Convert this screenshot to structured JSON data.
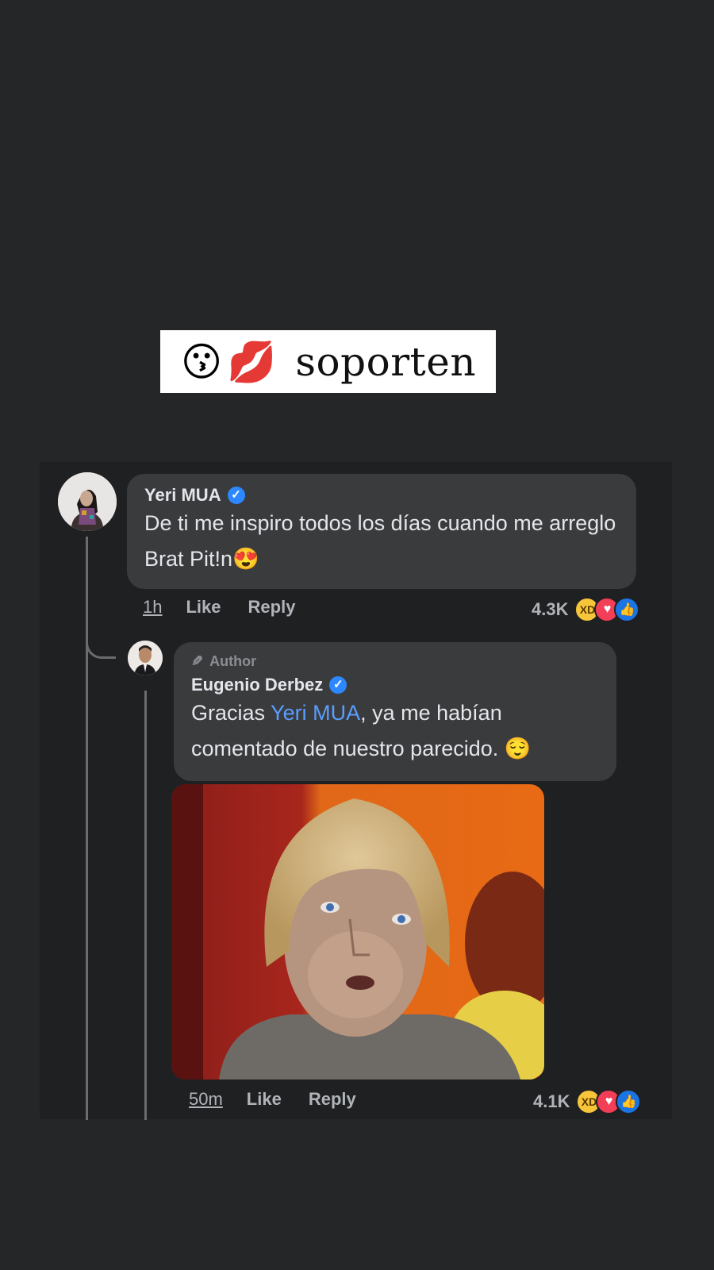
{
  "sticker": {
    "emoji_1": "😗",
    "emoji_2": "💋",
    "text": "soporten"
  },
  "comments": [
    {
      "author_name": "Yeri MUA",
      "verified": true,
      "text": "De ti me inspiro todos los días cuando me arreglo Brat Pit!n😍",
      "time": "1h",
      "like_label": "Like",
      "reply_label": "Reply",
      "reaction_count": "4.3K",
      "reactions": [
        "haha",
        "love",
        "like"
      ]
    }
  ],
  "reply": {
    "badge": "Author",
    "author_name": "Eugenio Derbez",
    "verified": true,
    "text_before": "Gracias ",
    "mention": "Yeri MUA",
    "text_after": ", ya me habían comentado de nuestro parecido. 😌",
    "time": "50m",
    "like_label": "Like",
    "reply_label": "Reply",
    "reaction_count": "4.1K",
    "reactions": [
      "haha",
      "love",
      "like"
    ]
  },
  "colors": {
    "background": "#252628",
    "bubble": "#3a3b3d",
    "mention": "#5b9dff",
    "verified": "#2d88ff"
  }
}
